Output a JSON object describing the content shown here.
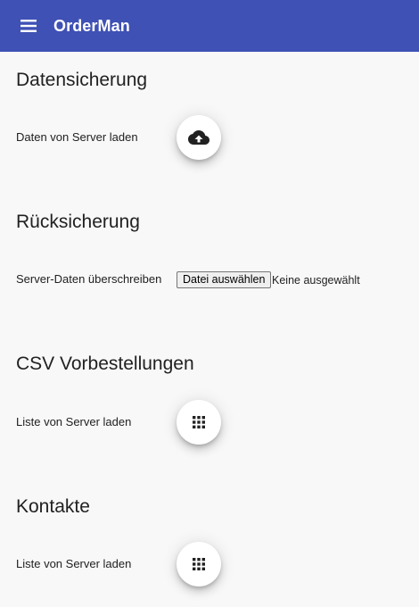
{
  "header": {
    "app_title": "OrderMan",
    "menu_icon": "menu-icon",
    "color": "#3f51b5"
  },
  "sections": [
    {
      "title": "Datensicherung",
      "label": "Daten von Server laden",
      "action_icon": "cloud-download-icon"
    },
    {
      "title": "Rücksicherung",
      "label": "Server-Daten überschreiben",
      "file_button_label": "Datei auswählen",
      "file_status": "Keine ausgewählt"
    },
    {
      "title": "CSV Vorbestellungen",
      "label": "Liste von Server laden",
      "action_icon": "grid-icon"
    },
    {
      "title": "Kontakte",
      "label": "Liste von Server laden",
      "action_icon": "grid-icon"
    }
  ]
}
